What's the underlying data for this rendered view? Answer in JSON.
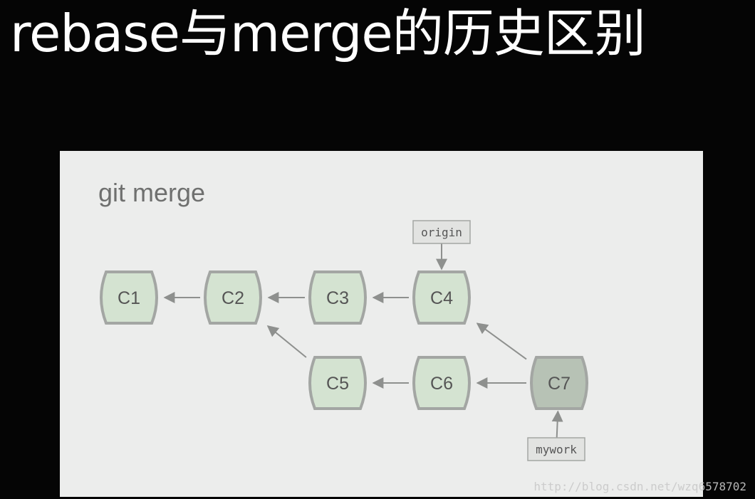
{
  "slide": {
    "title": "rebase与merge的历史区别"
  },
  "diagram": {
    "title": "git merge",
    "commits": [
      "C1",
      "C2",
      "C3",
      "C4",
      "C5",
      "C6",
      "C7"
    ],
    "refs": [
      "origin",
      "mywork"
    ],
    "edges": [
      [
        "C2",
        "C1"
      ],
      [
        "C3",
        "C2"
      ],
      [
        "C4",
        "C3"
      ],
      [
        "C5",
        "C2"
      ],
      [
        "C6",
        "C5"
      ],
      [
        "C7",
        "C6"
      ],
      [
        "C7",
        "C4"
      ],
      [
        "origin",
        "C4"
      ],
      [
        "mywork",
        "C7"
      ]
    ],
    "highlight_commit": "C7"
  },
  "colors": {
    "background": "#050505",
    "panel": "#ecedec",
    "commit_fill": "#d4e3d1",
    "commit_fill_highlight": "#b7c2b5",
    "commit_stroke": "#a3a6a3",
    "ref_fill": "#e2e3e1",
    "arrow": "#8e908e"
  },
  "watermark": "http://blog.csdn.net/wzq6578702"
}
